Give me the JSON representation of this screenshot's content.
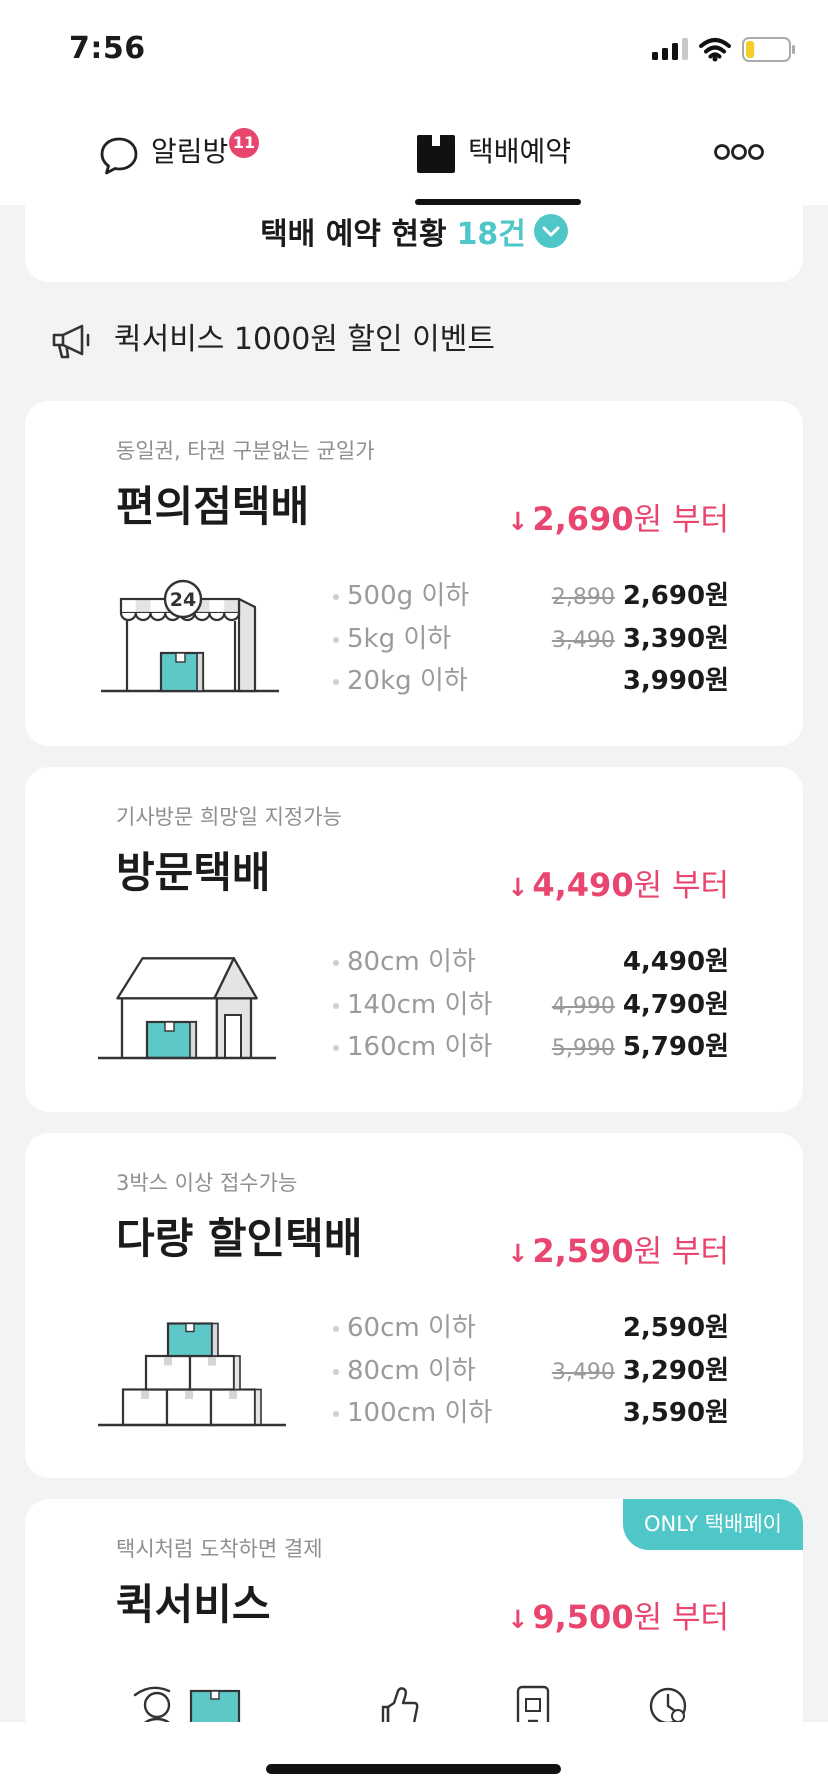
{
  "status_bar": {
    "time": "7:56",
    "signal_bars": 3,
    "battery_level": 0.2,
    "icons": [
      "signal-icon",
      "wifi-icon",
      "battery-icon"
    ]
  },
  "tabs": [
    {
      "label": "알림방",
      "badge": "11",
      "icon": "chat-bubble-icon"
    },
    {
      "label": "택배예약",
      "icon": "package-icon",
      "active": true
    },
    {
      "icon": "more-icon"
    }
  ],
  "reservation_status": {
    "label": "택배 예약 현황",
    "count": "18건",
    "icon": "chevron-down-icon"
  },
  "announcement": {
    "icon": "megaphone-icon",
    "text": "퀵서비스 1000원 할인 이벤트"
  },
  "cards": [
    {
      "subtitle": "동일권, 타권 구분없는 균일가",
      "title": "편의점택배",
      "price": {
        "arrow": "↓",
        "amount": "2,690",
        "suffix": "원 부터"
      },
      "illustration": "convenience-store",
      "sign_text": "24",
      "rows": [
        {
          "label": "500g 이하",
          "old_price": "2,890",
          "price": "2,690원"
        },
        {
          "label": "5kg 이하",
          "old_price": "3,490",
          "price": "3,390원"
        },
        {
          "label": "20kg 이하",
          "price": "3,990원"
        }
      ]
    },
    {
      "subtitle": "기사방문 희망일 지정가능",
      "title": "방문택배",
      "price": {
        "arrow": "↓",
        "amount": "4,490",
        "suffix": "원 부터"
      },
      "illustration": "house",
      "rows": [
        {
          "label": "80cm 이하",
          "price": "4,490원"
        },
        {
          "label": "140cm 이하",
          "old_price": "4,990",
          "price": "4,790원"
        },
        {
          "label": "160cm 이하",
          "old_price": "5,990",
          "price": "5,790원"
        }
      ]
    },
    {
      "subtitle": "3박스 이상 접수가능",
      "title": "다량 할인택배",
      "price": {
        "arrow": "↓",
        "amount": "2,590",
        "suffix": "원 부터"
      },
      "illustration": "stacked-boxes",
      "rows": [
        {
          "label": "60cm 이하",
          "price": "2,590원"
        },
        {
          "label": "80cm 이하",
          "old_price": "3,490",
          "price": "3,290원"
        },
        {
          "label": "100cm 이하",
          "price": "3,590원"
        }
      ]
    },
    {
      "subtitle": "택시처럼 도착하면 결제",
      "title": "퀵서비스",
      "price": {
        "arrow": "↓",
        "amount": "9,500",
        "suffix": "원 부터"
      },
      "badge": "ONLY 택배페이",
      "icons": [
        "courier-icon",
        "hand-icon",
        "mobile-package-icon",
        "clock-icon"
      ]
    }
  ],
  "colors": {
    "accent_teal": "#4fc6c8",
    "price_pink": "#e8456f",
    "background": "#f2f3f5",
    "text": "#1b1b1b"
  }
}
